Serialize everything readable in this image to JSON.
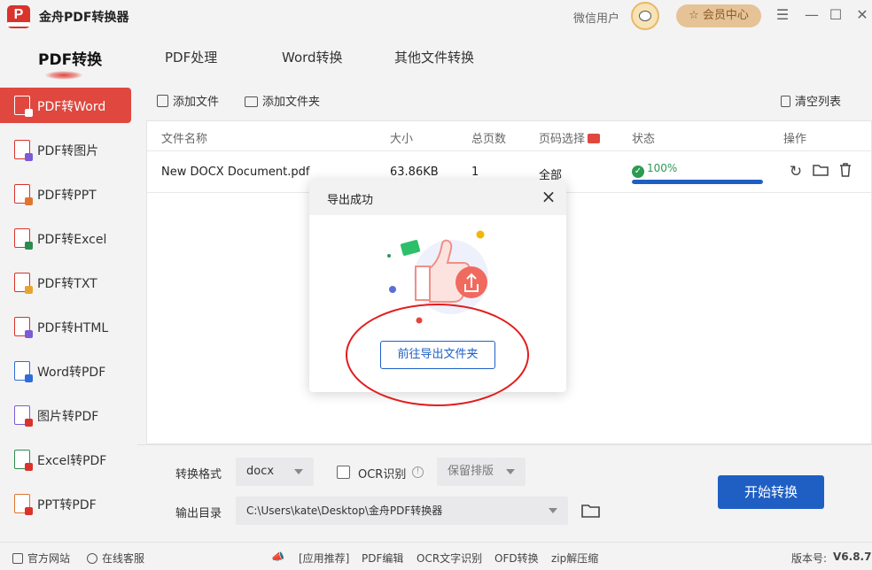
{
  "app": {
    "title": "金舟PDF转换器",
    "user_name": "微信用户",
    "vip_label": "会员中心"
  },
  "window_controls": [
    "menu-icon",
    "minimize-icon",
    "maximize-icon",
    "close-icon"
  ],
  "main_tabs": [
    {
      "label": "PDF转换",
      "active": true
    },
    {
      "label": "PDF处理"
    },
    {
      "label": "Word转换"
    },
    {
      "label": "其他文件转换"
    }
  ],
  "sidebar": {
    "items": [
      {
        "label": "PDF转Word",
        "active": true
      },
      {
        "label": "PDF转图片"
      },
      {
        "label": "PDF转PPT"
      },
      {
        "label": "PDF转Excel"
      },
      {
        "label": "PDF转TXT"
      },
      {
        "label": "PDF转HTML"
      },
      {
        "label": "Word转PDF"
      },
      {
        "label": "图片转PDF"
      },
      {
        "label": "Excel转PDF"
      },
      {
        "label": "PPT转PDF"
      }
    ]
  },
  "toolbar": {
    "add_file": "添加文件",
    "add_folder": "添加文件夹",
    "clear_list": "清空列表"
  },
  "table": {
    "headers": [
      "文件名称",
      "大小",
      "总页数",
      "页码选择",
      "状态",
      "操作"
    ],
    "rows": [
      {
        "name": "New DOCX Document.pdf",
        "size": "63.86KB",
        "pages": "1",
        "page_range": "全部",
        "status": "100%",
        "progress": 1.0
      }
    ]
  },
  "settings": {
    "format_label": "转换格式",
    "format_value": "docx",
    "ocr_label": "OCR识别",
    "layout_value": "保留排版",
    "output_label": "输出目录",
    "output_path": "C:\\Users\\kate\\Desktop\\金舟PDF转换器",
    "start_button": "开始转换"
  },
  "footer": {
    "website": "官方网站",
    "support": "在线客服",
    "links": [
      "[应用推荐]",
      "PDF编辑",
      "OCR文字识别",
      "OFD转换",
      "zip解压缩"
    ],
    "version_label": "版本号:",
    "version": "V6.8.7"
  },
  "modal": {
    "title": "导出成功",
    "button": "前往导出文件夹"
  },
  "colors": {
    "brand_red": "#e0473e",
    "primary_blue": "#1f5fc4",
    "success_green": "#2d9a52",
    "annotation_red": "#e31d1d"
  }
}
